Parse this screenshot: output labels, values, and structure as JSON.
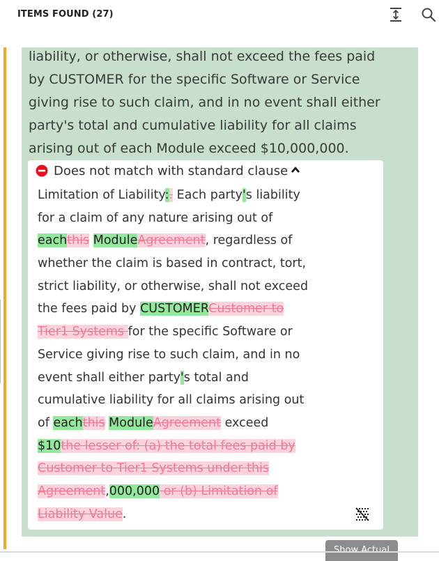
{
  "header": {
    "title": "ITEMS FOUND (27)",
    "icons": [
      "collapse-icon",
      "search-icon"
    ]
  },
  "clause": {
    "lines": [
      "liability, or otherwise, shall not exceed the fees paid",
      "by CUSTOMER for the specific Software or Service",
      "giving rise to such claim, and in no event shall either",
      "party's total and cumulative liability for all claims",
      "arising out of each Module exceed $10,000,000."
    ]
  },
  "card": {
    "status": "Does not match with standard clause",
    "redline_lines": [
      [
        {
          "t": "n",
          "v": "Limitation of Liability"
        },
        {
          "t": "i",
          "v": ":"
        },
        {
          "t": "d",
          "v": "."
        },
        {
          "t": "n",
          "v": " Each party"
        },
        {
          "t": "i",
          "v": "'"
        },
        {
          "t": "n",
          "v": "s liability"
        }
      ],
      [
        {
          "t": "n",
          "v": "for a claim of any nature arising out of"
        }
      ],
      [
        {
          "t": "i",
          "v": "each"
        },
        {
          "t": "d",
          "v": "this"
        },
        {
          "t": "n",
          "v": " "
        },
        {
          "t": "i",
          "v": "Module"
        },
        {
          "t": "d",
          "v": "Agreement"
        },
        {
          "t": "n",
          "v": ", regardless of"
        }
      ],
      [
        {
          "t": "n",
          "v": "whether the claim is based in contract, tort,"
        }
      ],
      [
        {
          "t": "n",
          "v": "strict liability, or otherwise, shall not exceed"
        }
      ],
      [
        {
          "t": "n",
          "v": "the fees paid by "
        },
        {
          "t": "i",
          "v": "CUSTOMER"
        },
        {
          "t": "d",
          "v": "Customer to"
        }
      ],
      [
        {
          "t": "d",
          "v": "Tier1 Systems "
        },
        {
          "t": "n",
          "v": "for the specific Software or"
        }
      ],
      [
        {
          "t": "n",
          "v": "Service giving rise to such claim, and in no"
        }
      ],
      [
        {
          "t": "n",
          "v": "event shall either party"
        },
        {
          "t": "i",
          "v": "'"
        },
        {
          "t": "n",
          "v": "s total and"
        }
      ],
      [
        {
          "t": "n",
          "v": "cumulative liability for all claims arising out"
        }
      ],
      [
        {
          "t": "n",
          "v": "of "
        },
        {
          "t": "i",
          "v": "each"
        },
        {
          "t": "d",
          "v": "this"
        },
        {
          "t": "n",
          "v": " "
        },
        {
          "t": "i",
          "v": "Module"
        },
        {
          "t": "d",
          "v": "Agreement"
        },
        {
          "t": "n",
          "v": " exceed"
        }
      ],
      [
        {
          "t": "i",
          "v": "$10"
        },
        {
          "t": "d",
          "v": "the lesser of: (a) the total fees paid by"
        }
      ],
      [
        {
          "t": "d",
          "v": "Customer to Tier1 Systems under this"
        }
      ],
      [
        {
          "t": "d",
          "v": "Agreement"
        },
        {
          "t": "n",
          "v": ","
        },
        {
          "t": "i",
          "v": "000,000"
        },
        {
          "t": "d",
          "v": " or (b) Limitation of"
        }
      ],
      [
        {
          "t": "d",
          "v": "Liability Value"
        },
        {
          "t": "n",
          "v": "."
        }
      ]
    ]
  },
  "show_actual_label": "Show Actual",
  "colors": {
    "accent": "#f5a623",
    "panel": "#c7dfcc",
    "insert": "#93e89e",
    "delete_bg": "#fbd3dc",
    "delete_text": "#f07a95",
    "error": "#e8121f"
  }
}
